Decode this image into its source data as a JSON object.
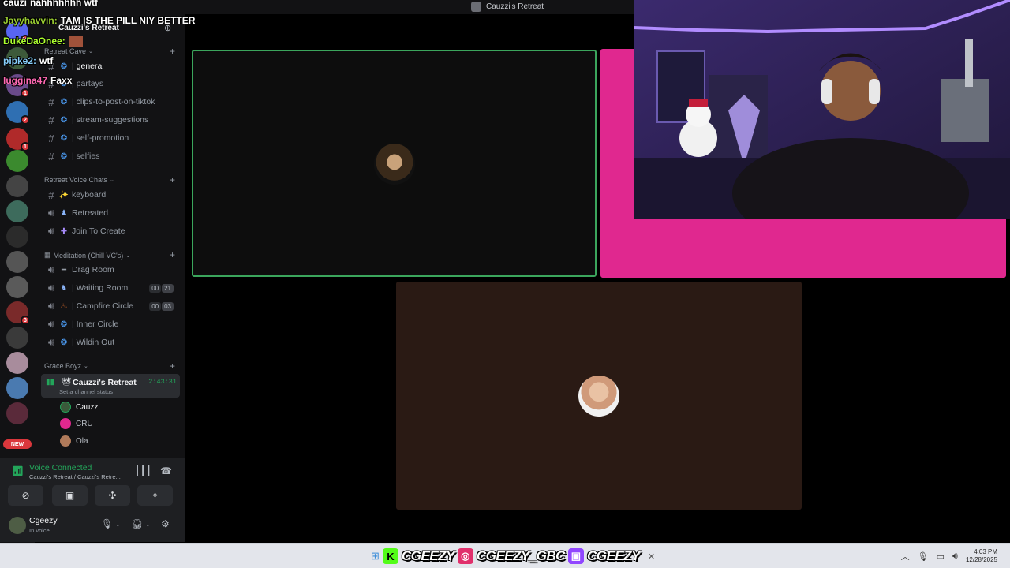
{
  "window": {
    "title": "Cauzzi's Retreat"
  },
  "rail": {
    "badges": [
      "10",
      "1",
      "2",
      "1",
      "3"
    ],
    "new_label": "NEW"
  },
  "server": {
    "name": "Cauzzi's Retreat"
  },
  "categories": {
    "retreat_cave": "Retreat Cave",
    "retreat_voice": "Retreat Voice Chats",
    "meditation": "Meditation (Chill VC's)",
    "grace_boyz": "Grace Boyz"
  },
  "text_channels": [
    {
      "name": "| general"
    },
    {
      "name": "| partays"
    },
    {
      "name": "| clips-to-post-on-tiktok"
    },
    {
      "name": "| stream-suggestions"
    },
    {
      "name": "| self-promotion"
    },
    {
      "name": "| selfies"
    }
  ],
  "voice_channels": [
    {
      "name": "keyboard"
    },
    {
      "name": "Retreated"
    },
    {
      "name": "Join To Create"
    }
  ],
  "meditation_channels": [
    {
      "name": "Drag Room"
    },
    {
      "name": "| Waiting Room",
      "count_a": "00",
      "count_b": "21"
    },
    {
      "name": "| Campfire Circle",
      "count_a": "00",
      "count_b": "03"
    },
    {
      "name": "| Inner Circle"
    },
    {
      "name": "| Wildin Out"
    }
  ],
  "active_voice": {
    "name": "Cauzzi's Retreat",
    "status": "Set a channel status",
    "timer": "2:43:31",
    "members": [
      "Cauzzi",
      "CRU",
      "Ola"
    ]
  },
  "voice_panel": {
    "connected": "Voice Connected",
    "location": "Cauzzi's Retreat / Cauzzi's Retre..."
  },
  "user": {
    "name": "Cgeezy",
    "status": "In voice"
  },
  "chat": [
    {
      "user": "cauzi",
      "text": "nahhhhhhh wtf",
      "color": "#ffffff"
    },
    {
      "user": "Jayyhavvin:",
      "text": "TAM IS THE PILL NIY BETTER",
      "color": "#9acd32"
    },
    {
      "user": "DukeDaOnee:",
      "text": "",
      "color": "#adff2f"
    },
    {
      "user": "pipke2:",
      "text": "wtf",
      "color": "#87cefa"
    },
    {
      "user": "luggina47",
      "text": "Faxx",
      "color": "#ff69b4"
    }
  ],
  "socials": [
    {
      "icon": "kick-icon",
      "glyph": "K",
      "color": "#53fc18",
      "handle": "CGEEZY"
    },
    {
      "icon": "instagram-icon",
      "glyph": "◎",
      "color": "#e1306c",
      "handle": "CGEEZY_GBC"
    },
    {
      "icon": "twitch-icon",
      "glyph": "▣",
      "color": "#9146ff",
      "handle": "CGEEZY"
    }
  ],
  "clock": {
    "time": "4:03 PM",
    "date": "12/28/2025"
  }
}
